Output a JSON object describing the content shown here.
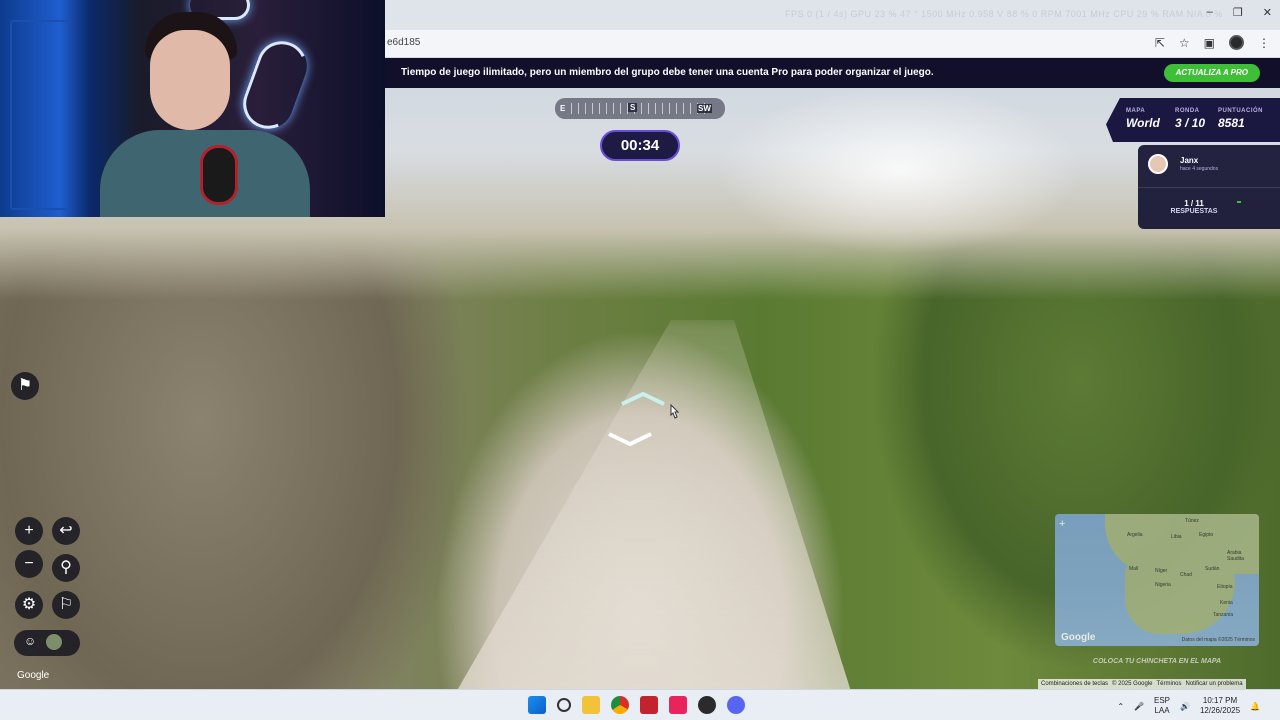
{
  "browser": {
    "url_fragment": "e6d185",
    "stats_overlay": "FPS  0  (1 / 4s)    GPU  23 %  47 °  1500 MHz  0.958 V  88 %  0 RPM  7001 MHz    CPU  29 %    RAM  N/A  0 %"
  },
  "banner": {
    "message": "Tiempo de juego ilimitado, pero un miembro del grupo debe tener una cuenta Pro para poder organizar el juego.",
    "upgrade_label": "ACTUALIZA A PRO"
  },
  "compass": {
    "left": "E",
    "center": "S",
    "right": "SW"
  },
  "timer": "00:34",
  "game": {
    "map_label": "MAPA",
    "map_value": "World",
    "round_label": "RONDA",
    "round_value": "3 / 10",
    "score_label": "PUNTUACIÓN",
    "score_value": "8581"
  },
  "player": {
    "name": "Janx",
    "time": "hace 4 segundos",
    "answers_count": "1 / 11",
    "answers_label": "RESPUESTAS"
  },
  "street_view": {
    "google_label": "Google"
  },
  "minimap": {
    "labels": [
      "Túnez",
      "Argelia",
      "Libia",
      "Egipto",
      "Arabia Saudita",
      "Malí",
      "Níger",
      "Chad",
      "Sudán",
      "Nigeria",
      "Etiopía",
      "Kenia",
      "Tanzania"
    ],
    "google_label": "Google",
    "credits": "Datos del mapa ©2025   Términos",
    "place_pin": "COLOCA TU CHINCHETA EN EL MAPA"
  },
  "footer": {
    "shortcuts": "Combinaciones de teclas",
    "copyright": "© 2025 Google",
    "terms": "Términos",
    "report": "Notificar un problema"
  },
  "taskbar": {
    "lang_line1": "ESP",
    "lang_line2": "LAA",
    "time": "10:17 PM",
    "date": "12/26/2025"
  }
}
